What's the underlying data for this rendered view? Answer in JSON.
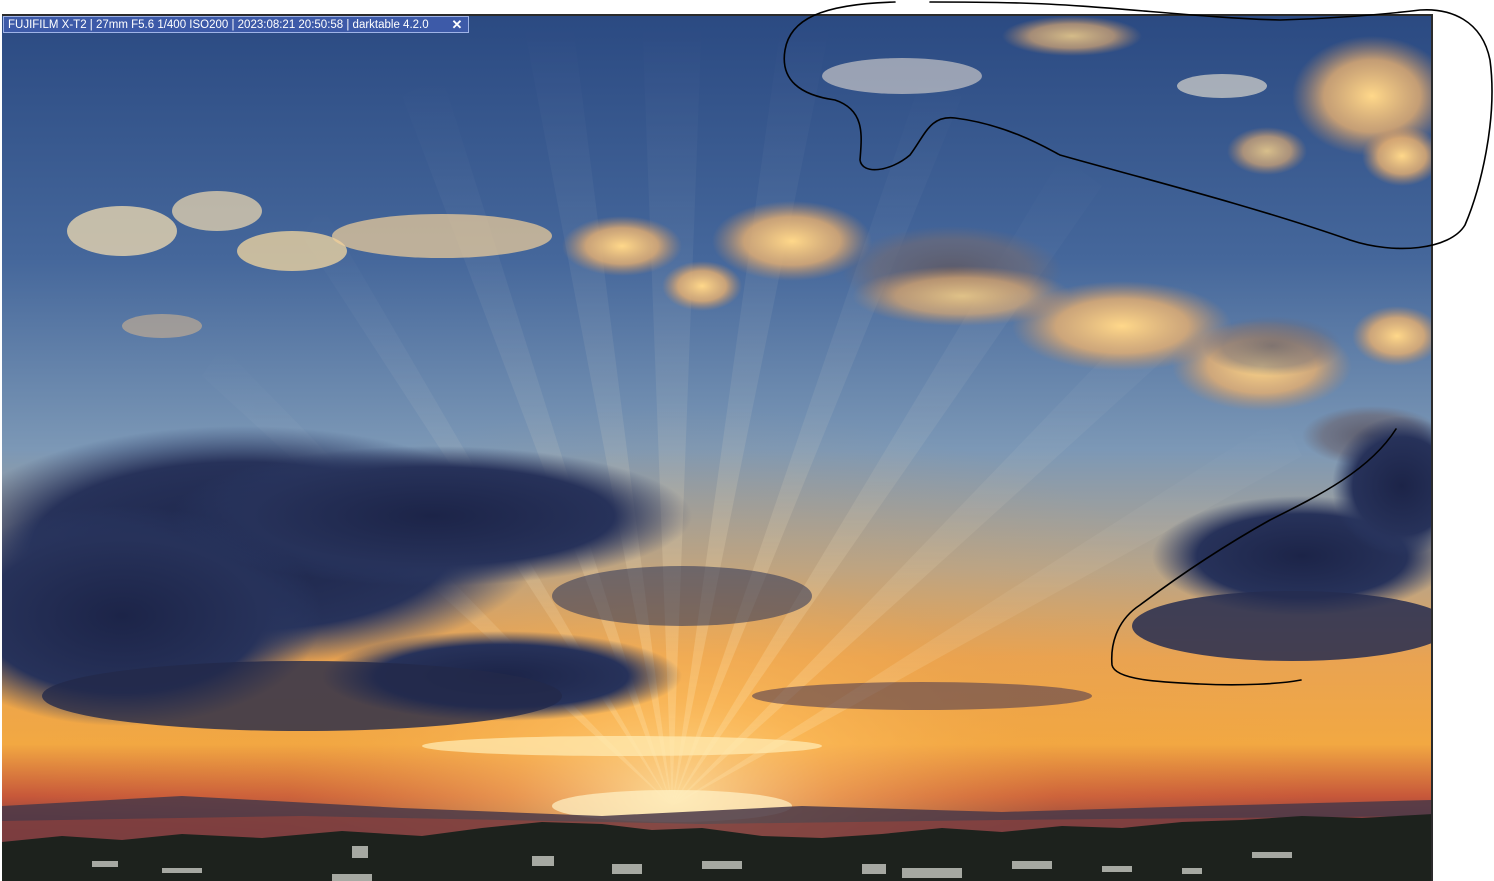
{
  "viewer": {
    "info_bar": {
      "text": "FUJIFILM X-T2 | 27mm F5.6 1/400 ISO200 | 2023:08:21 20:50:58 | darktable 4.2.0",
      "close_label": "✕",
      "close_icon": "close-icon"
    },
    "photo": {
      "subject": "sunset sky with crepuscular rays over hillside town",
      "colors": {
        "sky_top": "#2e4f86",
        "sky_mid": "#6b8db4",
        "horizon_glow": "#f0a040",
        "sun_core": "#ffd98a",
        "dark_cloud": "#1f2748",
        "town": "#1a1f1a"
      }
    },
    "annotations": {
      "stroke_color": "#000000",
      "shapes": [
        "freehand-loop-top-right",
        "freehand-hook-right"
      ]
    }
  }
}
